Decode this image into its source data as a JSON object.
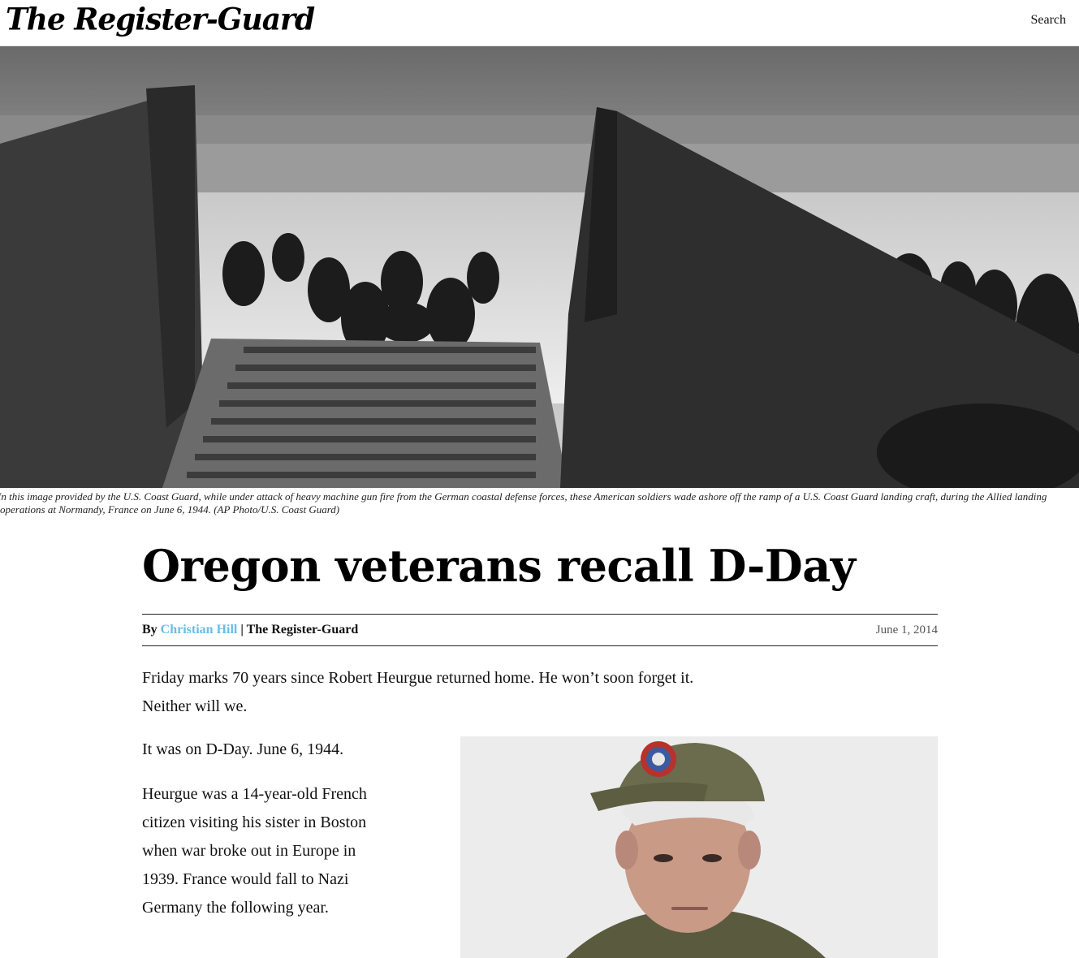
{
  "header": {
    "masthead": "The Register-Guard",
    "search_label": "Search"
  },
  "hero": {
    "caption": "In this image provided by the U.S. Coast Guard, while under attack of heavy machine gun fire from the German coastal defense forces, these American soldiers wade ashore off the ramp of a U.S. Coast Guard landing craft, during the Allied landing operations at Normandy, France on June 6, 1944. (AP Photo/U.S. Coast Guard)"
  },
  "article": {
    "headline": "Oregon veterans recall D-Day",
    "byline_prefix": "By",
    "author": "Christian Hill",
    "byline_separator": "|",
    "publication": "The Register-Guard",
    "date": "June 1, 2014",
    "paragraphs": [
      "Friday marks 70 years since Robert Heurgue returned home. He won’t soon forget it. Neither will we.",
      "It was on D-Day. June 6, 1944.",
      "Heurgue was a 14-year-old French citizen visiting his sister in Boston when war broke out in Europe in 1939. France would fall to Nazi Germany the following year."
    ]
  },
  "colors": {
    "author_link": "#69bde6",
    "rule": "#222222"
  }
}
